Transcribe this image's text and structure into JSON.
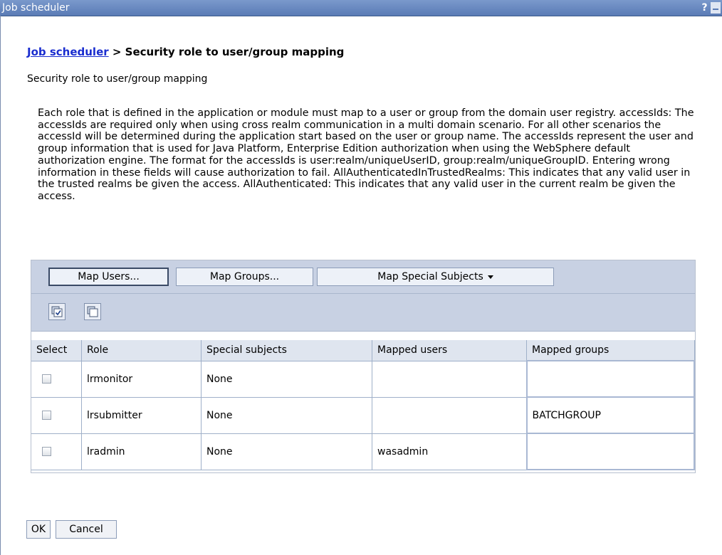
{
  "window": {
    "title": "Job scheduler",
    "help_glyph": "?"
  },
  "breadcrumb": {
    "link": "Job scheduler",
    "separator": " > ",
    "current": "Security role to user/group mapping"
  },
  "page_subtitle": "Security role to user/group mapping",
  "description": "Each role that is defined in the application or module must map to a user or group from the domain user registry. accessIds: The accessIds are required only when using cross realm communication in a multi domain scenario. For all other scenarios the accessId will be determined during the application start based on the user or group name. The accessIds represent the user and group information that is used for Java Platform, Enterprise Edition authorization when using the WebSphere default authorization engine. The format for the accessIds is user:realm/uniqueUserID, group:realm/uniqueGroupID. Entering wrong information in these fields will cause authorization to fail. AllAuthenticatedInTrustedRealms: This indicates that any valid user in the trusted realms be given the access. AllAuthenticated: This indicates that any valid user in the current realm be given the access.",
  "toolbar": {
    "map_users": "Map Users...",
    "map_groups": "Map Groups...",
    "map_special": "Map Special Subjects",
    "icons": [
      "select-all-icon",
      "deselect-all-icon"
    ]
  },
  "table": {
    "headers": [
      "Select",
      "Role",
      "Special subjects",
      "Mapped users",
      "Mapped groups"
    ],
    "rows": [
      {
        "role": "lrmonitor",
        "special": "None",
        "users": "",
        "groups": ""
      },
      {
        "role": "lrsubmitter",
        "special": "None",
        "users": "",
        "groups": "BATCHGROUP"
      },
      {
        "role": "lradmin",
        "special": "None",
        "users": "wasadmin",
        "groups": ""
      }
    ]
  },
  "actions": {
    "ok": "OK",
    "cancel": "Cancel"
  },
  "colors": {
    "titlebar": "#6a89c0",
    "toolbar": "#c8d1e3",
    "link": "#1a2dcf",
    "header": "#dfe5ef"
  }
}
